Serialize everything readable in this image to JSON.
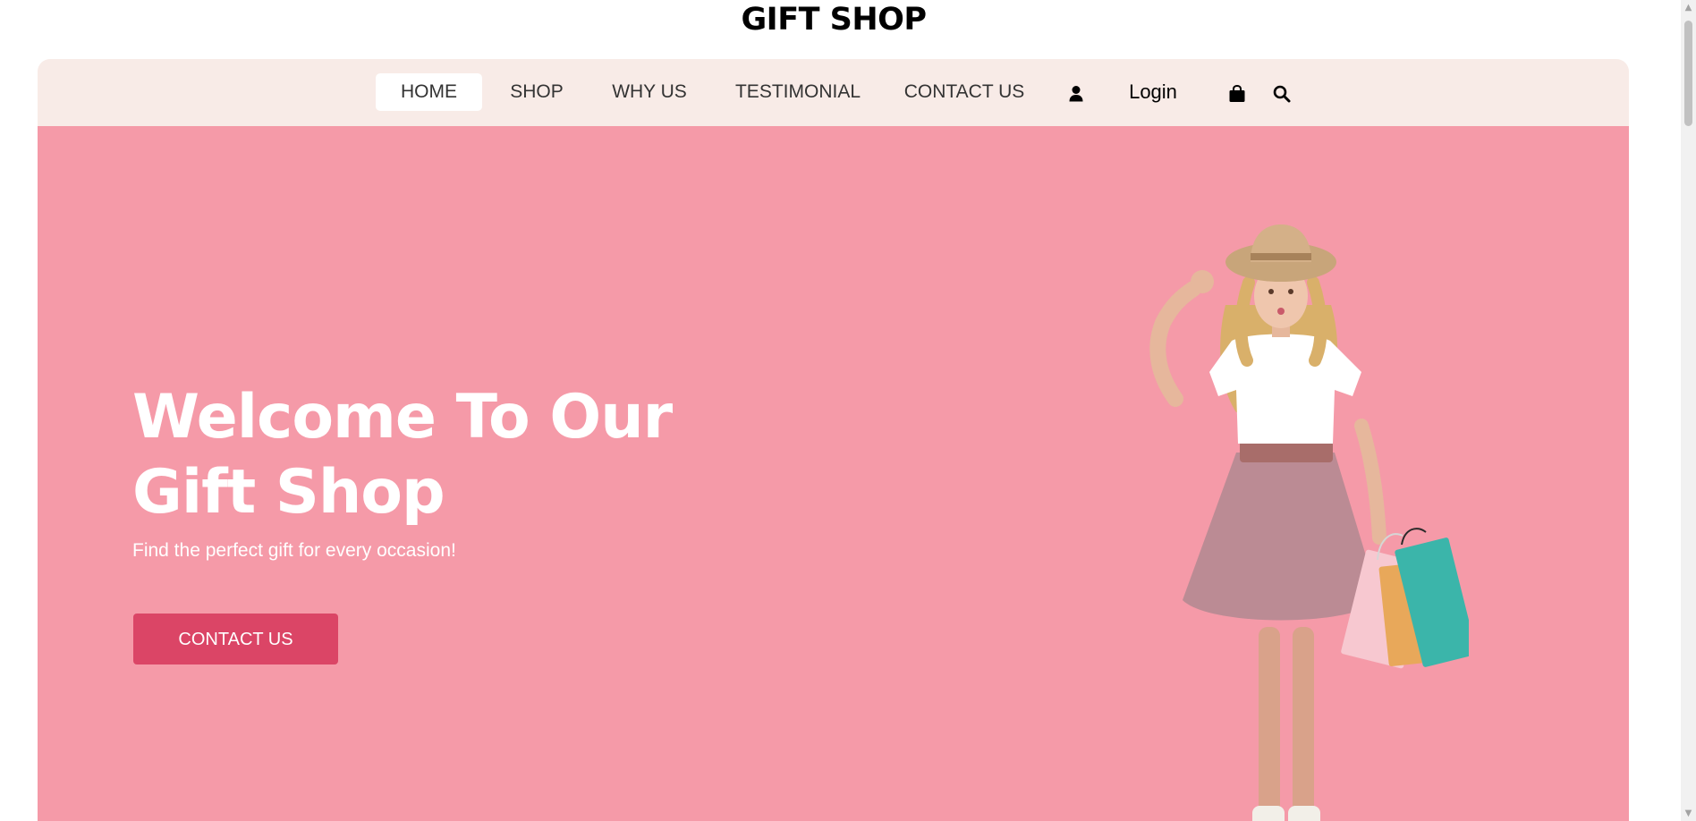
{
  "site": {
    "title": "GIFT SHOP"
  },
  "nav": {
    "items": [
      {
        "label": "HOME",
        "active": true
      },
      {
        "label": "SHOP",
        "active": false
      },
      {
        "label": "WHY US",
        "active": false
      },
      {
        "label": "TESTIMONIAL",
        "active": false
      },
      {
        "label": "CONTACT US",
        "active": false
      }
    ],
    "login_label": "Login",
    "icons": {
      "user": "user-icon",
      "cart": "shopping-bag-icon",
      "search": "search-icon"
    }
  },
  "hero": {
    "title_line1": "Welcome To Our",
    "title_line2": "Gift Shop",
    "subtitle": "Find the perfect gift for every occasion!",
    "cta_label": "CONTACT US",
    "image_alt": "girl with shopping bags"
  },
  "colors": {
    "nav_background": "#f8ebe7",
    "hero_background": "#f59aa8",
    "cta_background": "#db4566",
    "active_tab_background": "#ffffff"
  }
}
